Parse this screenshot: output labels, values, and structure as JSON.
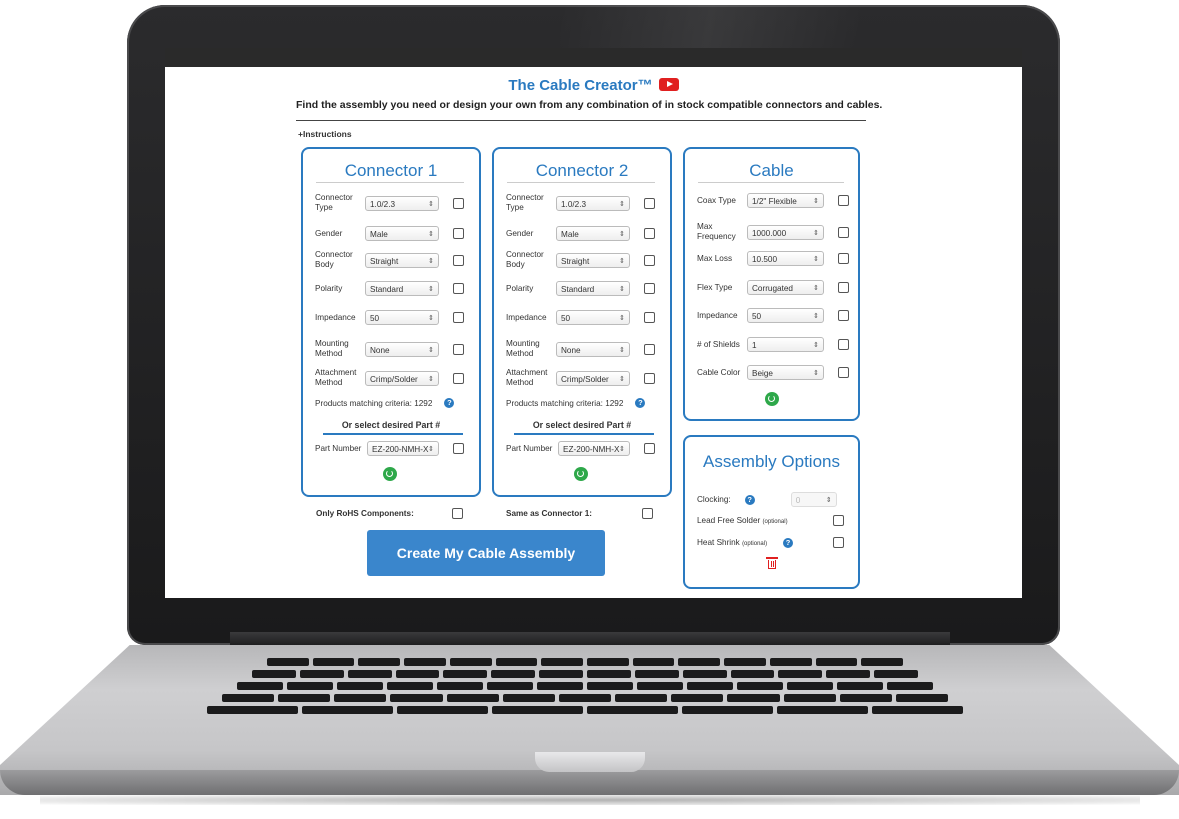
{
  "app": {
    "title": "The Cable Creator™",
    "subtitle": "Find the assembly you need or design your own from any combination of in stock compatible connectors and cables.",
    "instructions_link": "+Instructions",
    "youtube_icon": "youtube-icon"
  },
  "connector1": {
    "title": "Connector 1",
    "fields": [
      {
        "label": "Connector Type",
        "value": "1.0/2.3"
      },
      {
        "label": "Gender",
        "value": "Male"
      },
      {
        "label": "Connector Body",
        "value": "Straight"
      },
      {
        "label": "Polarity",
        "value": "Standard"
      },
      {
        "label": "Impedance",
        "value": "50"
      },
      {
        "label": "Mounting Method",
        "value": "None"
      },
      {
        "label": "Attachment Method",
        "value": "Crimp/Solder"
      }
    ],
    "products_matching": "Products matching criteria: 1292",
    "or_select": "Or select desired Part #",
    "part_label": "Part Number",
    "part_value": "EZ-200-NMH-X"
  },
  "connector2": {
    "title": "Connector 2",
    "fields": [
      {
        "label": "Connector Type",
        "value": "1.0/2.3"
      },
      {
        "label": "Gender",
        "value": "Male"
      },
      {
        "label": "Connector Body",
        "value": "Straight"
      },
      {
        "label": "Polarity",
        "value": "Standard"
      },
      {
        "label": "Impedance",
        "value": "50"
      },
      {
        "label": "Mounting Method",
        "value": "None"
      },
      {
        "label": "Attachment Method",
        "value": "Crimp/Solder"
      }
    ],
    "products_matching": "Products matching criteria: 1292",
    "or_select": "Or select desired Part #",
    "part_label": "Part Number",
    "part_value": "EZ-200-NMH-X"
  },
  "cable": {
    "title": "Cable",
    "fields": [
      {
        "label": "Coax Type",
        "value": "1/2\" Flexible"
      },
      {
        "label": "Max Frequency",
        "value": "1000.000"
      },
      {
        "label": "Max Loss",
        "value": "10.500"
      },
      {
        "label": "Flex Type",
        "value": "Corrugated"
      },
      {
        "label": "Impedance",
        "value": "50"
      },
      {
        "label": "# of Shields",
        "value": "1"
      },
      {
        "label": "Cable Color",
        "value": "Beige"
      }
    ]
  },
  "assembly": {
    "title": "Assembly Options",
    "clocking_label": "Clocking:",
    "clocking_value": "0",
    "lead_free": "Lead Free Solder",
    "heat_shrink": "Heat Shrink",
    "optional": "(optional)"
  },
  "footer": {
    "rohs": "Only RoHS Components:",
    "same_as": "Same as Connector 1:",
    "create_button": "Create My Cable Assembly"
  },
  "colors": {
    "accent": "#2a7ac0",
    "button": "#3a86cc",
    "refresh": "#2ea84a",
    "delete": "#e02020"
  }
}
